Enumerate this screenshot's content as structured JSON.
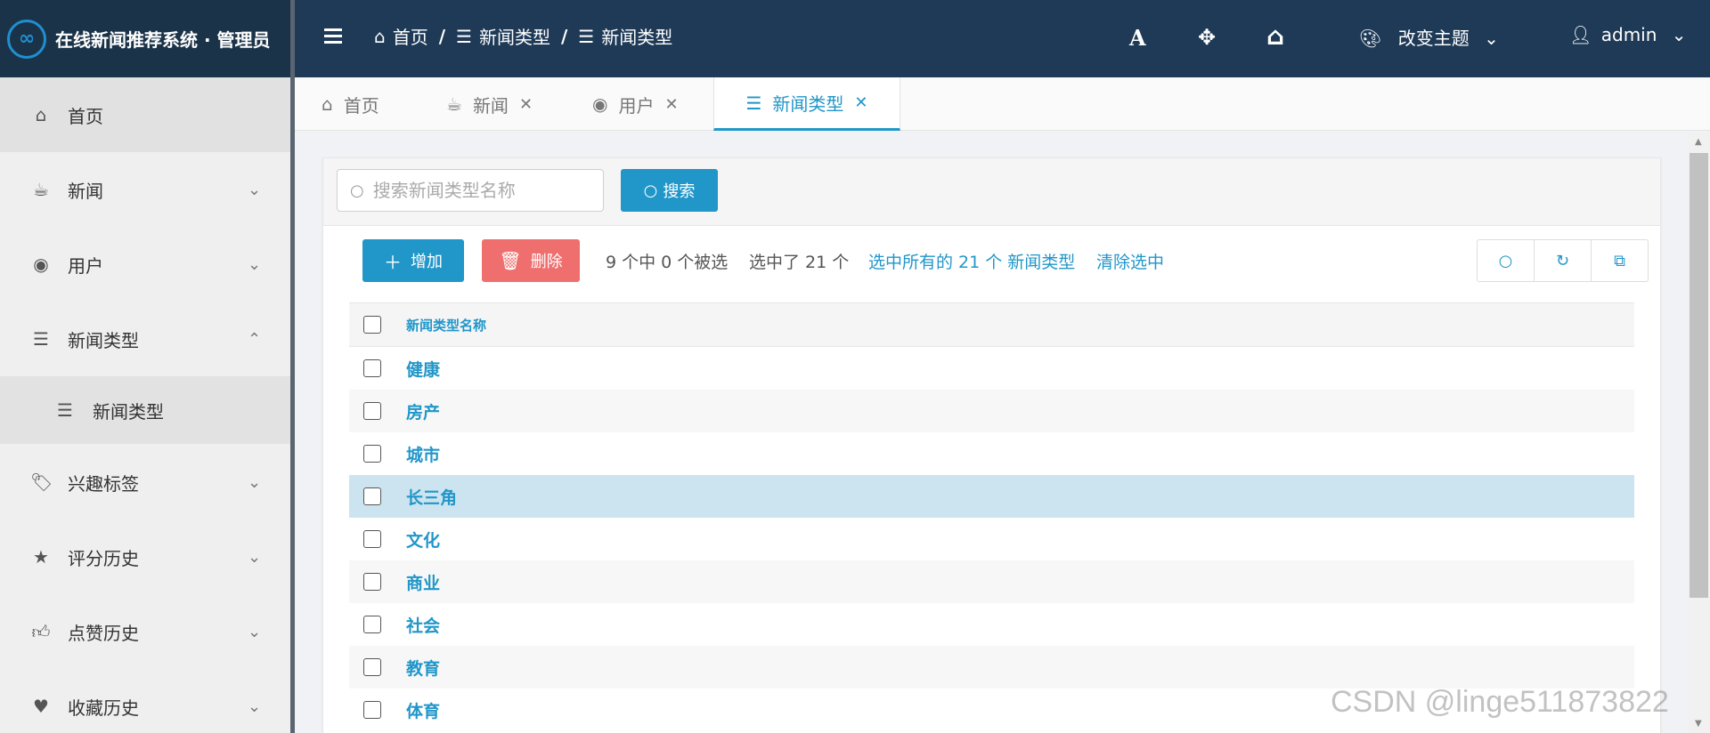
{
  "app": {
    "title": "在线新闻推荐系统 · 管理员",
    "logo_glyph": "∞"
  },
  "header": {
    "breadcrumb": [
      "首页",
      "新闻类型",
      "新闻类型"
    ],
    "font_icon": "A",
    "fullscreen_icon": "✥",
    "home_icon": "⌂",
    "theme_label": "改变主题",
    "user_label": "admin"
  },
  "sidebar": {
    "items": [
      {
        "label": "首页",
        "icon": "home-icon"
      },
      {
        "label": "新闻",
        "icon": "coffee-icon"
      },
      {
        "label": "用户",
        "icon": "user-circle-icon"
      },
      {
        "label": "新闻类型",
        "icon": "list-icon"
      },
      {
        "label": "新闻类型",
        "icon": "list-icon"
      },
      {
        "label": "兴趣标签",
        "icon": "tags-icon"
      },
      {
        "label": "评分历史",
        "icon": "star-icon"
      },
      {
        "label": "点赞历史",
        "icon": "thumbs-up-icon"
      },
      {
        "label": "收藏历史",
        "icon": "heart-icon"
      }
    ]
  },
  "tabs": [
    {
      "label": "首页"
    },
    {
      "label": "新闻"
    },
    {
      "label": "用户"
    },
    {
      "label": "新闻类型"
    }
  ],
  "search": {
    "placeholder": "搜索新闻类型名称",
    "button_label": "搜索"
  },
  "toolbar": {
    "add_label": "增加",
    "delete_label": "删除",
    "selected_count_text": "9 个中 0 个被选",
    "selected_total_text": "选中了 21 个",
    "select_all_text": "选中所有的 21 个 新闻类型",
    "clear_selection_text": "清除选中"
  },
  "table": {
    "header": "新闻类型名称",
    "rows": [
      "健康",
      "房产",
      "城市",
      "长三角",
      "文化",
      "商业",
      "社会",
      "教育",
      "体育"
    ]
  },
  "watermark": "CSDN @linge511873822",
  "colors": {
    "header_bg": "#1f3a57",
    "accent": "#2196c9",
    "danger": "#ef6f6f",
    "row_highlight": "#cce4ef"
  }
}
